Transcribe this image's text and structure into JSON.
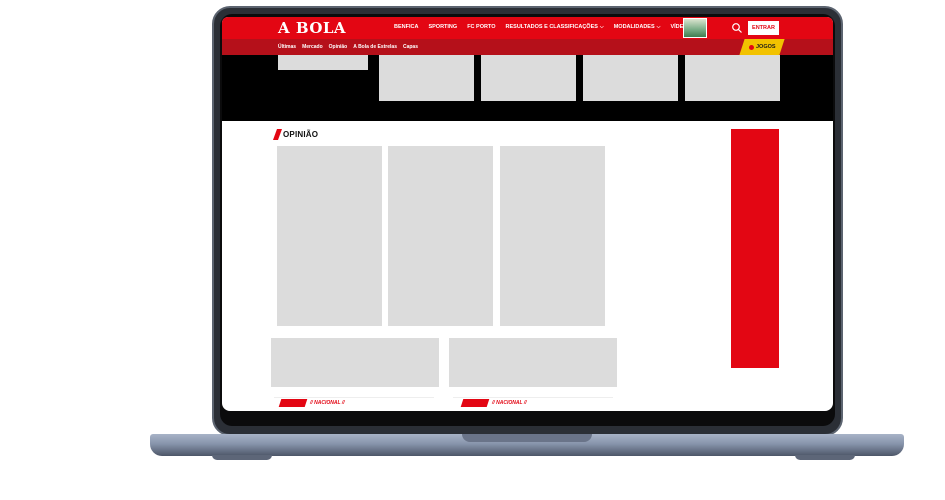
{
  "header": {
    "logo": "A BOLA",
    "nav": [
      {
        "label": "BENFICA",
        "dropdown": false
      },
      {
        "label": "SPORTING",
        "dropdown": false
      },
      {
        "label": "FC PORTO",
        "dropdown": false
      },
      {
        "label": "RESULTADOS E CLASSIFICAÇÕES",
        "dropdown": true
      },
      {
        "label": "MODALIDADES",
        "dropdown": true
      },
      {
        "label": "VÍDEOS",
        "dropdown": true
      }
    ],
    "login_label": "ENTRAR",
    "search_icon": "search-icon",
    "accent_color": "#e30613"
  },
  "subnav": {
    "items": [
      "Últimas",
      "Mercado",
      "Opinião",
      "A Bola de Estrelas",
      "Capas"
    ],
    "jogos_label": "JOGOS"
  },
  "opinion": {
    "title": "OPINIÃO"
  },
  "teasers": [
    {
      "label": "// NACIONAL //"
    },
    {
      "label": "// NACIONAL //"
    }
  ]
}
